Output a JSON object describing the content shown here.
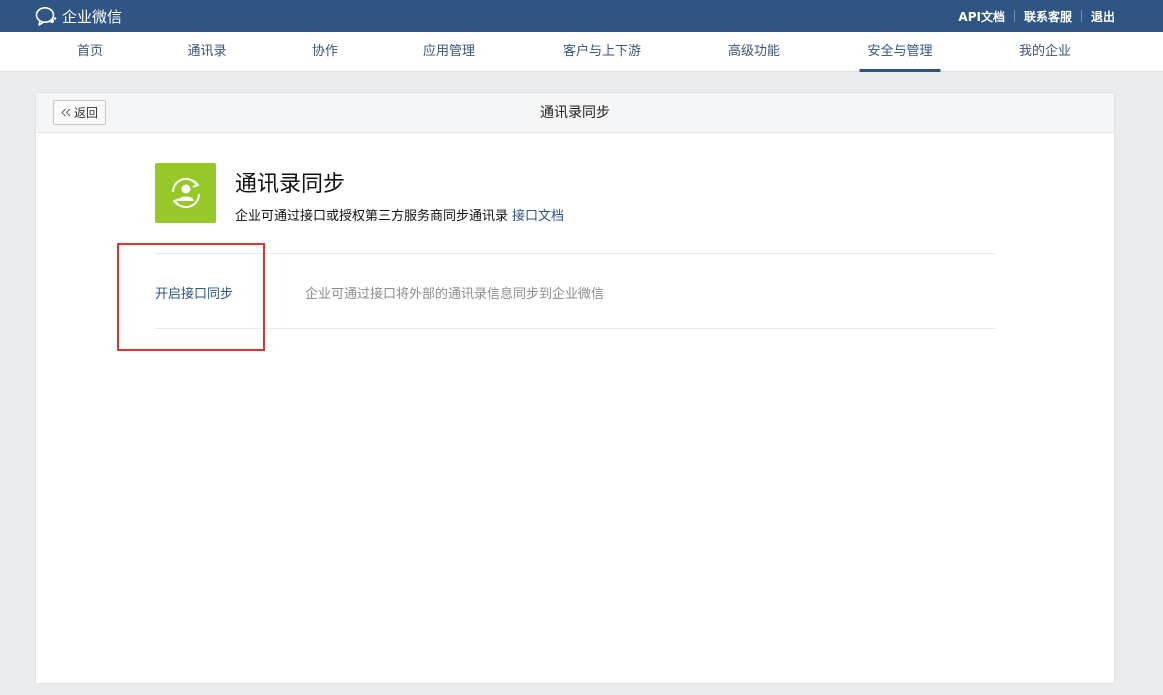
{
  "topbar": {
    "app_name": "企业微信",
    "links": [
      "API文档",
      "联系客服",
      "退出"
    ]
  },
  "nav": {
    "items": [
      "首页",
      "通讯录",
      "协作",
      "应用管理",
      "客户与上下游",
      "高级功能",
      "安全与管理",
      "我的企业"
    ],
    "active": "安全与管理"
  },
  "panel": {
    "back_label": "返回",
    "title": "通讯录同步"
  },
  "app": {
    "icon": "contact-sync-icon",
    "icon_color": "#97c82a",
    "title": "通讯录同步",
    "description": "企业可通过接口或授权第三方服务商同步通讯录",
    "doc_link": "接口文档"
  },
  "option": {
    "label": "开启接口同步",
    "description": "企业可通过接口将外部的通讯录信息同步到企业微信"
  },
  "colors": {
    "brand": "#2f5584",
    "highlight": "#e3312f"
  }
}
